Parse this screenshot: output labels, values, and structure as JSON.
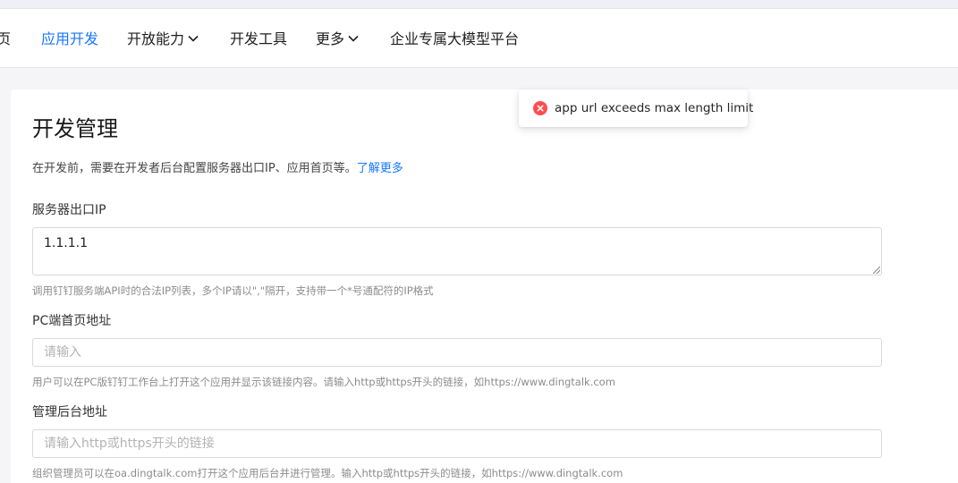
{
  "nav": {
    "items": [
      {
        "label": "页",
        "active": false,
        "dropdown": false
      },
      {
        "label": "应用开发",
        "active": true,
        "dropdown": false
      },
      {
        "label": "开放能力",
        "active": false,
        "dropdown": true
      },
      {
        "label": "开发工具",
        "active": false,
        "dropdown": false
      },
      {
        "label": "更多",
        "active": false,
        "dropdown": true
      },
      {
        "label": "企业专属大模型平台",
        "active": false,
        "dropdown": false
      }
    ]
  },
  "main": {
    "title": "开发管理",
    "description": "在开发前，需要在开发者后台配置服务器出口IP、应用首页等。",
    "learn_more": "了解更多",
    "fields": {
      "server_ip": {
        "label": "服务器出口IP",
        "value": "1.1.1.1",
        "hint": "调用钉钉服务端API时的合法IP列表，多个IP请以\",\"隔开，支持带一个*号通配符的IP格式"
      },
      "pc_home": {
        "label": "PC端首页地址",
        "placeholder": "请输入",
        "hint": "用户可以在PC版钉钉工作台上打开这个应用并显示该链接内容。请输入http或https开头的链接，如https://www.dingtalk.com"
      },
      "admin_url": {
        "label": "管理后台地址",
        "placeholder": "请输入http或https开头的链接",
        "hint": "组织管理员可以在oa.dingtalk.com打开这个应用后台并进行管理。输入http或https开头的链接，如https://www.dingtalk.com"
      }
    }
  },
  "toast": {
    "type": "error",
    "icon": "error-circle-icon",
    "message": "app url exceeds max length limit"
  },
  "colors": {
    "accent": "#1677ff",
    "error": "#ff4d4f"
  }
}
